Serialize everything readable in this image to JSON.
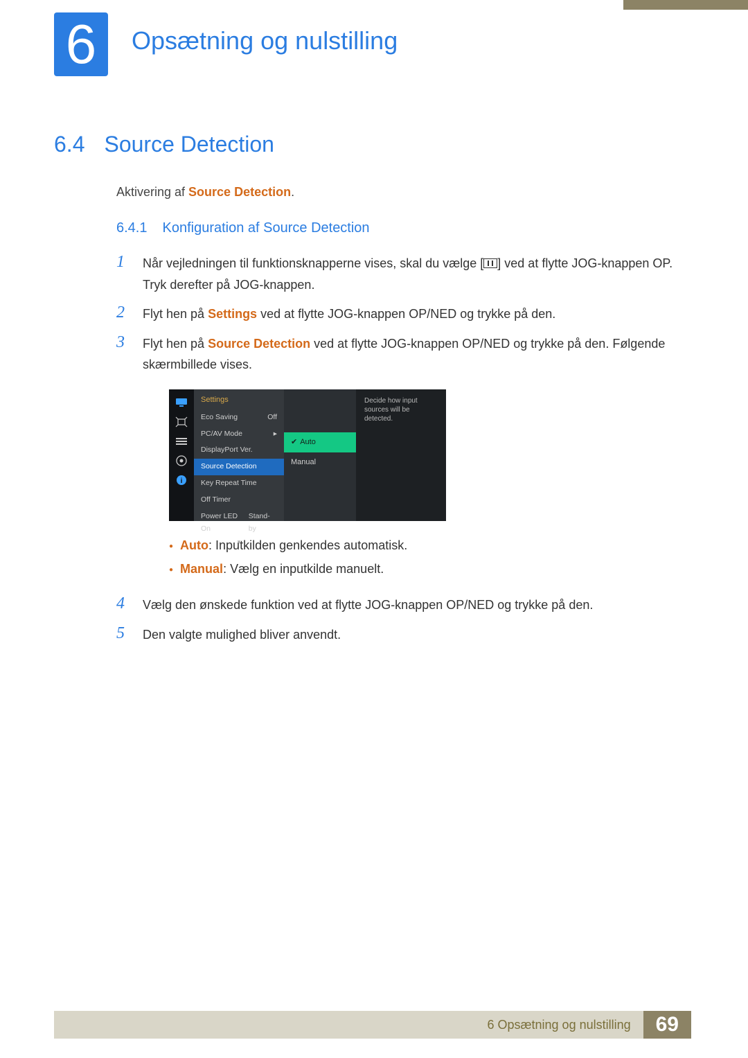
{
  "chapter": {
    "number": "6",
    "title": "Opsætning og nulstilling"
  },
  "section": {
    "number": "6.4",
    "title": "Source Detection"
  },
  "intro": {
    "prefix": "Aktivering af ",
    "keyword": "Source Detection",
    "suffix": "."
  },
  "subsection": {
    "number": "6.4.1",
    "title": "Konfiguration af Source Detection"
  },
  "steps": {
    "s1": {
      "pre": "Når vejledningen til funktionsknapperne vises, skal du vælge [",
      "post": "] ved at flytte JOG-knappen OP. Tryk derefter på JOG-knappen."
    },
    "s2": {
      "pre": "Flyt hen på ",
      "kw": "Settings",
      "post": " ved at flytte JOG-knappen OP/NED og trykke på den."
    },
    "s3": {
      "pre": "Flyt hen på ",
      "kw": "Source Detection",
      "post": " ved at flytte JOG-knappen OP/NED og trykke på den. Følgende skærmbillede vises."
    },
    "s4": "Vælg den ønskede funktion ved at flytte JOG-knappen OP/NED og trykke på den.",
    "s5": "Den valgte mulighed bliver anvendt."
  },
  "bullets": {
    "b1": {
      "kw": "Auto",
      "rest": ": Inputkilden genkendes automatisk."
    },
    "b2": {
      "kw": "Manual",
      "rest": ": Vælg en inputkilde manuelt."
    }
  },
  "osd": {
    "title": "Settings",
    "items": {
      "i0": {
        "label": "Eco Saving",
        "value": "Off"
      },
      "i1": {
        "label": "PC/AV Mode",
        "value": "▸"
      },
      "i2": {
        "label": "DisplayPort Ver.",
        "value": ""
      },
      "i3": {
        "label": "Source Detection",
        "value": ""
      },
      "i4": {
        "label": "Key Repeat Time",
        "value": ""
      },
      "i5": {
        "label": "Off Timer",
        "value": ""
      },
      "i6": {
        "label": "Power LED On",
        "value": "Stand-by"
      }
    },
    "options": {
      "o0": "Auto",
      "o1": "Manual"
    },
    "help": "Decide how input sources will be detected."
  },
  "footer": {
    "text": "6 Opsætning og nulstilling",
    "page": "69"
  }
}
